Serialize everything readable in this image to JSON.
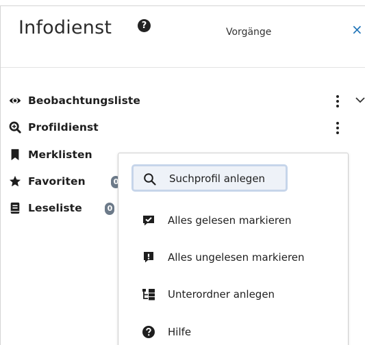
{
  "header": {
    "title": "Infodienst",
    "help_icon": "question-circle-icon",
    "tab_label": "Vorgänge",
    "close_glyph": "×"
  },
  "sidebar": {
    "items": [
      {
        "label": "Beobachtungsliste",
        "icon": "eye-icon"
      },
      {
        "label": "Profildienst",
        "icon": "search-plus-icon"
      },
      {
        "label": "Merklisten",
        "icon": "bookmark-icon"
      },
      {
        "label": "Favoriten",
        "icon": "star-icon",
        "badge": "0"
      },
      {
        "label": "Leseliste",
        "icon": "book-icon",
        "badge": "0"
      }
    ]
  },
  "context_menu": {
    "items": [
      {
        "label": "Suchprofil anlegen",
        "icon": "search-icon"
      },
      {
        "label": "Alles gelesen markieren",
        "icon": "comment-check-icon"
      },
      {
        "label": "Alles ungelesen markieren",
        "icon": "comment-exclamation-icon"
      },
      {
        "label": "Unterordner anlegen",
        "icon": "folder-tree-icon"
      },
      {
        "label": "Hilfe",
        "icon": "question-circle-icon"
      }
    ]
  },
  "colors": {
    "accent": "#1f74b8",
    "focus_ring": "#c6d5ea",
    "focus_bg": "#eef2f8",
    "badge": "#6c7a89"
  }
}
